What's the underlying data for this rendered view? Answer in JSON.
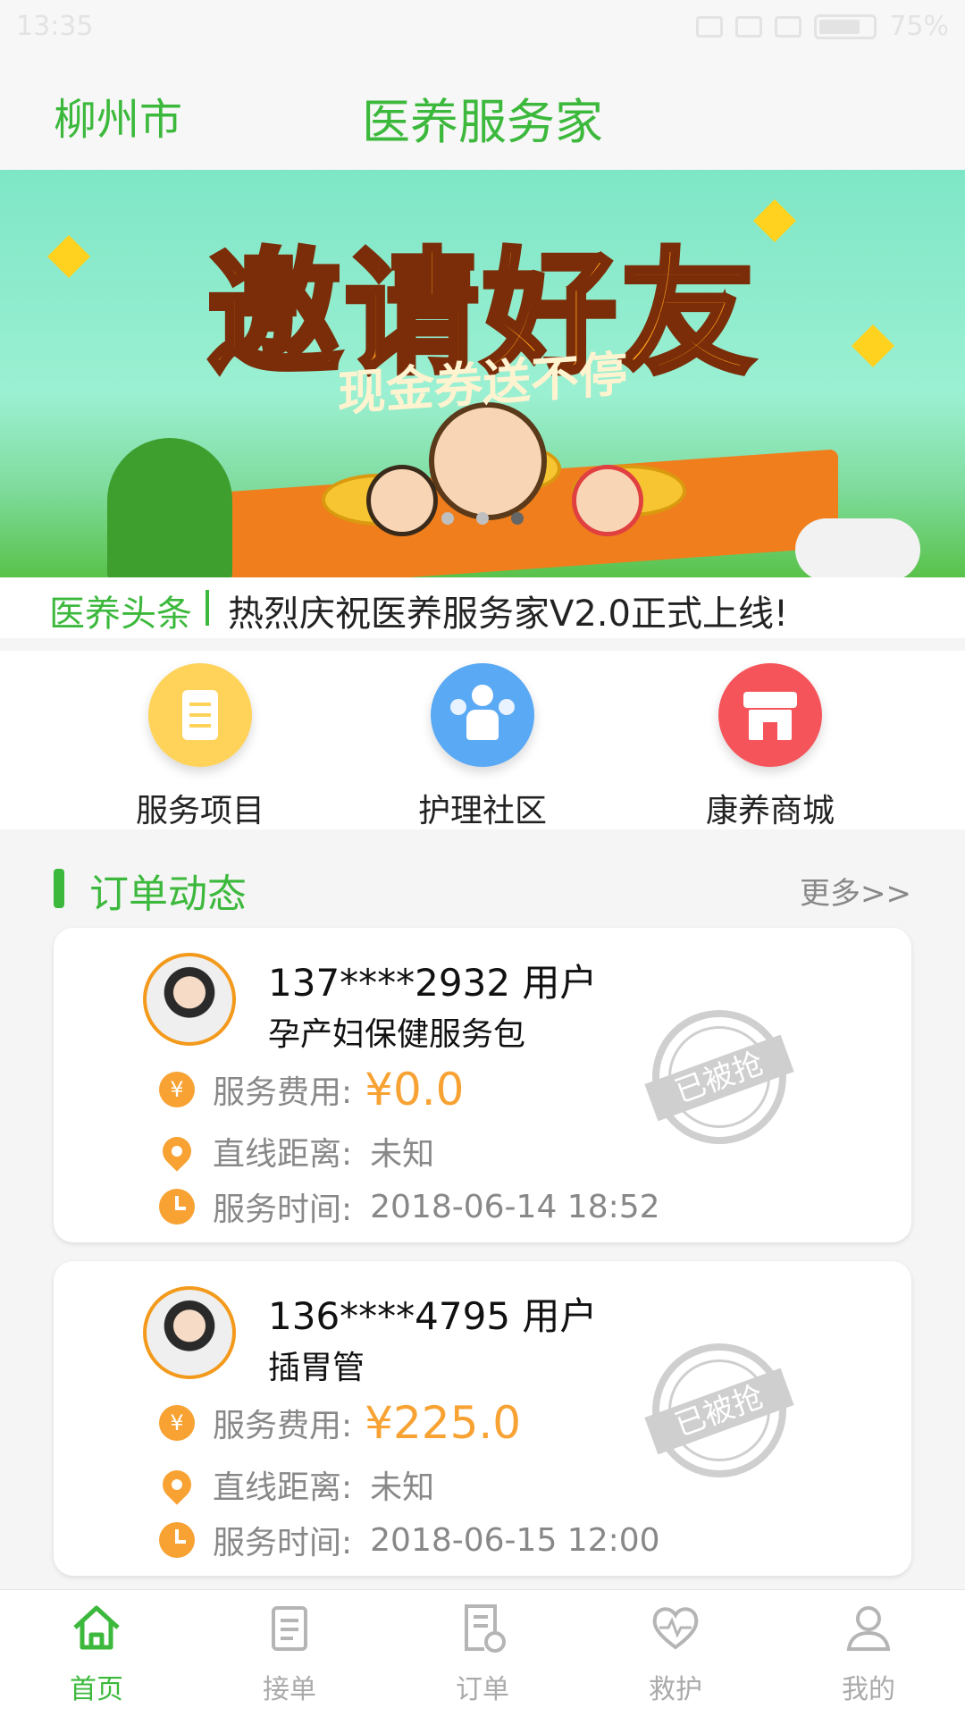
{
  "status_bar": {
    "time": "13:35",
    "battery": "75%"
  },
  "header": {
    "city": "柳州市",
    "title": "医养服务家"
  },
  "banner": {
    "title": "邀请好友",
    "subtitle": "现金券送不停"
  },
  "headline": {
    "label": "医养头条",
    "text": "热烈庆祝医养服务家V2.0正式上线!"
  },
  "menu": {
    "items": [
      {
        "label": "服务项目",
        "icon": "document-icon",
        "color": "#ffd35a"
      },
      {
        "label": "护理社区",
        "icon": "community-icon",
        "color": "#5aa9f4"
      },
      {
        "label": "康养商城",
        "icon": "shop-icon",
        "color": "#f5555a"
      }
    ]
  },
  "section": {
    "title": "订单动态",
    "more": "更多>>"
  },
  "orders": [
    {
      "user": "137****2932 用户",
      "service": "孕产妇保健服务包",
      "fee_label": "服务费用:",
      "fee": "¥0.0",
      "distance_label": "直线距离:",
      "distance": "未知",
      "time_label": "服务时间:",
      "time": "2018-06-14 18:52",
      "stamp": "已被抢"
    },
    {
      "user": "136****4795 用户",
      "service": "插胃管",
      "fee_label": "服务费用:",
      "fee": "¥225.0",
      "distance_label": "直线距离:",
      "distance": "未知",
      "time_label": "服务时间:",
      "time": "2018-06-15 12:00",
      "stamp": "已被抢"
    }
  ],
  "tabbar": {
    "items": [
      {
        "label": "首页",
        "icon": "home-icon",
        "active": true
      },
      {
        "label": "接单",
        "icon": "clipboard-icon",
        "active": false
      },
      {
        "label": "订单",
        "icon": "order-icon",
        "active": false
      },
      {
        "label": "救护",
        "icon": "heart-pulse-icon",
        "active": false
      },
      {
        "label": "我的",
        "icon": "user-icon",
        "active": false
      }
    ]
  },
  "colors": {
    "brand_green": "#3cb93c",
    "accent_orange": "#f7a233"
  }
}
